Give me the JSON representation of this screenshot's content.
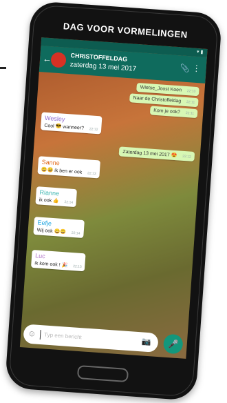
{
  "caption": "DAG VOOR VORMELINGEN",
  "chat": {
    "title": "CHRISTOFFELDAG",
    "subtitle": "zaterdag 13 mei 2017"
  },
  "messages": [
    {
      "dir": "out",
      "text": "Wietse_Joost Koen",
      "time": "22:10"
    },
    {
      "dir": "out",
      "text": "Naar de Christoffeldag",
      "time": "22:11"
    },
    {
      "dir": "out",
      "text": "Kom je ook?",
      "time": "22:11"
    },
    {
      "dir": "in",
      "sender": "Wesley",
      "sender_color": "#8e6ad1",
      "text": "Cool 😎 wanneer?",
      "time": "22:12"
    },
    {
      "dir": "out",
      "text": "Zaterdag 13 mei 2017 😍",
      "time": "22:12"
    },
    {
      "dir": "in",
      "sender": "Sanne",
      "sender_color": "#e26a1b",
      "text": "😄😄 ik ben er ook",
      "time": "22:13"
    },
    {
      "dir": "in",
      "sender": "Rianne",
      "sender_color": "#3db6b0",
      "text": "ik ook 👍",
      "time": "22:14"
    },
    {
      "dir": "in",
      "sender": "Eefje",
      "sender_color": "#1fa5e0",
      "text": "Wij ook 😄😄",
      "time": "22:14"
    },
    {
      "dir": "in",
      "sender": "Luc",
      "sender_color": "#b074c8",
      "text": "ik kom ook ! 🎉",
      "time": "22:15"
    }
  ],
  "input": {
    "placeholder": "Typ een bericht"
  },
  "icons": {
    "back": "back-arrow-icon",
    "attach": "paperclip-icon",
    "more": "more-vert-icon",
    "emoji": "emoji-icon",
    "camera": "camera-icon",
    "mic": "mic-icon"
  },
  "colors": {
    "appbar": "#0f6b5d",
    "outgoing": "#d7f7b4",
    "incoming": "#ffffff",
    "avatar": "#d63124",
    "mic": "#13977c"
  }
}
